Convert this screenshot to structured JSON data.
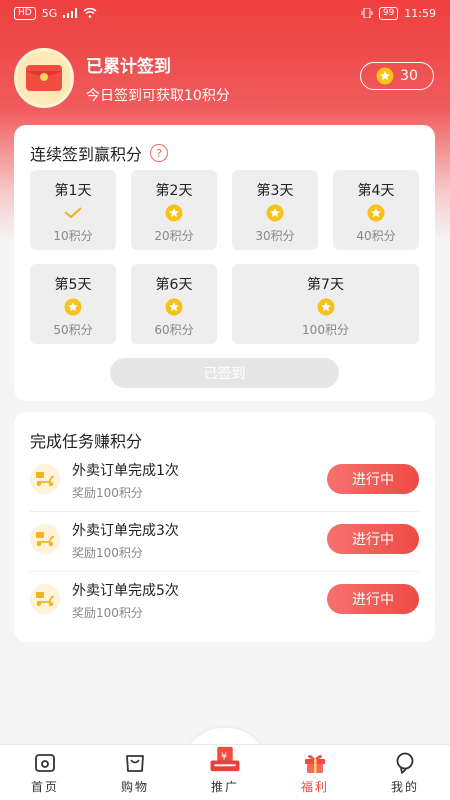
{
  "status_bar": {
    "hd": "HD",
    "net": "5G",
    "battery": "99",
    "time": "11:59"
  },
  "profile": {
    "title": "已累计签到",
    "subtitle": "今日签到可获取10积分",
    "coins": "30"
  },
  "signin": {
    "title": "连续签到赢积分",
    "help": "?",
    "days": [
      {
        "label": "第1天",
        "points": "10积分",
        "state": "checked"
      },
      {
        "label": "第2天",
        "points": "20积分",
        "state": "coin"
      },
      {
        "label": "第3天",
        "points": "30积分",
        "state": "coin"
      },
      {
        "label": "第4天",
        "points": "40积分",
        "state": "coin"
      },
      {
        "label": "第5天",
        "points": "50积分",
        "state": "coin"
      },
      {
        "label": "第6天",
        "points": "60积分",
        "state": "coin"
      },
      {
        "label": "第7天",
        "points": "100积分",
        "state": "coin"
      }
    ],
    "button_label": "已签到"
  },
  "tasks": {
    "title": "完成任务赚积分",
    "items": [
      {
        "name": "外卖订单完成1次",
        "reward": "奖励100积分",
        "button": "进行中"
      },
      {
        "name": "外卖订单完成3次",
        "reward": "奖励100积分",
        "button": "进行中"
      },
      {
        "name": "外卖订单完成5次",
        "reward": "奖励100积分",
        "button": "进行中"
      }
    ]
  },
  "tabbar": {
    "items": [
      {
        "label": "首页",
        "icon": "home-icon"
      },
      {
        "label": "购物",
        "icon": "shopping-bag-icon"
      },
      {
        "label": "推广",
        "icon": "promote-icon"
      },
      {
        "label": "福利",
        "icon": "gift-icon"
      },
      {
        "label": "我的",
        "icon": "profile-icon"
      }
    ],
    "active": "福利"
  },
  "colors": {
    "accent": "#ee3f3f",
    "coin": "#f7c21b",
    "button": "#ef4a44"
  }
}
